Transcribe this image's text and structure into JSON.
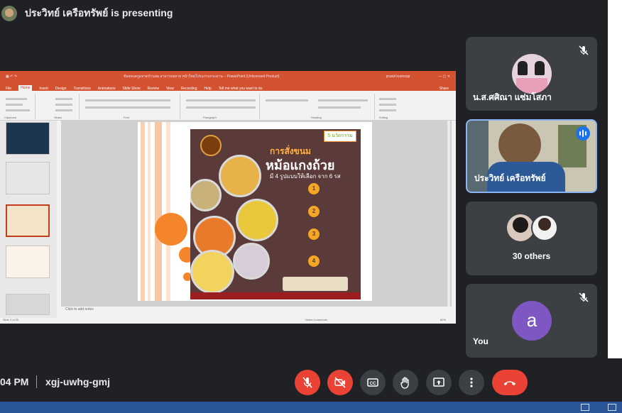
{
  "header": {
    "presenting_text": "ประวิทย์ เครือทรัพย์ is presenting"
  },
  "slide_window": {
    "ppt_title": "ข้อสอบครูมหาดบ้านสม สามารถสลาย หน้าใหม่โปรแกรมกระดาน -- PowerPoint (Unlicensed Product)",
    "account": "prawit krainsop",
    "tabs": [
      "File",
      "Home",
      "Insert",
      "Design",
      "Transitions",
      "Animations",
      "Slide Show",
      "Review",
      "View",
      "Recording",
      "Help",
      "Tell me what you want to do"
    ],
    "share": "Share",
    "ribbon_groups": [
      "Clipboard",
      "Slides",
      "Font",
      "Paragraph",
      "Drawing",
      "Editing"
    ],
    "click_to_add_notes": "Click to add notes",
    "status_left": "Slide 3 of 25",
    "status_right": "Notes   Comments",
    "zoom": "82%"
  },
  "poster": {
    "badge": "5 นวัตกรรม",
    "heading_small": "การสั่งขนม",
    "heading_large": "หม้อแกงถ้วย",
    "subheading": "มี 4 รูปแบบให้เลือก จาก 6 รส",
    "steps": [
      "1",
      "2",
      "3",
      "4"
    ]
  },
  "participants": [
    {
      "name": "น.ส.ศศิณา แซ่มโสภา",
      "muted": true
    },
    {
      "name": "ประวิทย์ เครือทรัพย์",
      "speaking": true
    },
    {
      "name": "30 others"
    },
    {
      "name": "You",
      "avatar_letter": "a",
      "muted": true
    }
  ],
  "meeting": {
    "time": "04 PM",
    "code": "xgj-uwhg-gmj"
  },
  "colors": {
    "mic_off": "#ea4335",
    "accent": "#8ab4f8",
    "speaking": "#1a73e8",
    "you_avatar": "#7e57c2"
  },
  "controls": [
    "mic-off-icon",
    "camera-off-icon",
    "captions-icon",
    "raise-hand-icon",
    "present-icon",
    "more-options-icon",
    "end-call-icon"
  ]
}
